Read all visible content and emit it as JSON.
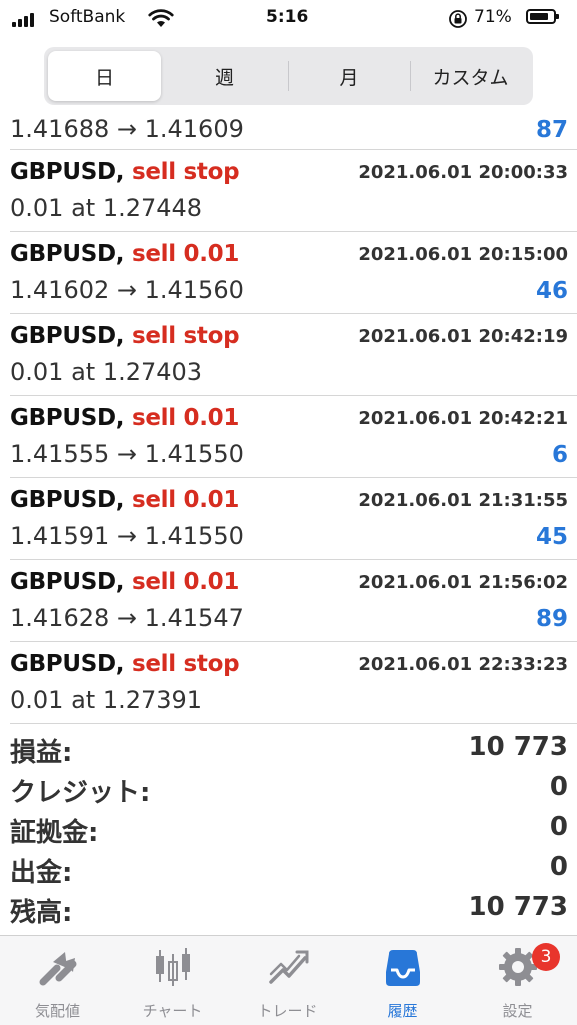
{
  "status_bar": {
    "carrier": "SoftBank",
    "time": "5:16",
    "battery": "71%"
  },
  "period_tabs": [
    {
      "label": "日",
      "active": true
    },
    {
      "label": "週",
      "active": false
    },
    {
      "label": "月",
      "active": false
    },
    {
      "label": "カスタム",
      "active": false
    }
  ],
  "history": {
    "partial_row": {
      "price": "1.41688 → 1.41609",
      "profit": "87"
    },
    "rows": [
      {
        "symbol": "GBPUSD,",
        "action": "sell stop",
        "time": "2021.06.01 20:00:33",
        "price": "0.01 at 1.27448",
        "profit": ""
      },
      {
        "symbol": "GBPUSD,",
        "action": "sell 0.01",
        "time": "2021.06.01 20:15:00",
        "price": "1.41602 → 1.41560",
        "profit": "46"
      },
      {
        "symbol": "GBPUSD,",
        "action": "sell stop",
        "time": "2021.06.01 20:42:19",
        "price": "0.01 at 1.27403",
        "profit": ""
      },
      {
        "symbol": "GBPUSD,",
        "action": "sell 0.01",
        "time": "2021.06.01 20:42:21",
        "price": "1.41555 → 1.41550",
        "profit": "6"
      },
      {
        "symbol": "GBPUSD,",
        "action": "sell 0.01",
        "time": "2021.06.01 21:31:55",
        "price": "1.41591 → 1.41550",
        "profit": "45"
      },
      {
        "symbol": "GBPUSD,",
        "action": "sell 0.01",
        "time": "2021.06.01 21:56:02",
        "price": "1.41628 → 1.41547",
        "profit": "89"
      },
      {
        "symbol": "GBPUSD,",
        "action": "sell stop",
        "time": "2021.06.01 22:33:23",
        "price": "0.01 at 1.27391",
        "profit": ""
      }
    ]
  },
  "summary": [
    {
      "label": "損益:",
      "value": "10 773"
    },
    {
      "label": "クレジット:",
      "value": "0"
    },
    {
      "label": "証拠金:",
      "value": "0"
    },
    {
      "label": "出金:",
      "value": "0"
    },
    {
      "label": "残高:",
      "value": "10 773"
    }
  ],
  "tab_bar": {
    "items": [
      {
        "label": "気配値",
        "icon": "quotes-icon",
        "active": false
      },
      {
        "label": "チャート",
        "icon": "chart-icon",
        "active": false
      },
      {
        "label": "トレード",
        "icon": "trade-icon",
        "active": false
      },
      {
        "label": "履歴",
        "icon": "history-icon",
        "active": true
      },
      {
        "label": "設定",
        "icon": "gear-icon",
        "active": false
      }
    ],
    "settings_badge": "3"
  },
  "colors": {
    "accent": "#2877d8",
    "sell": "#d62d20",
    "badge": "#e8352c",
    "inactive": "#8e8e93"
  }
}
